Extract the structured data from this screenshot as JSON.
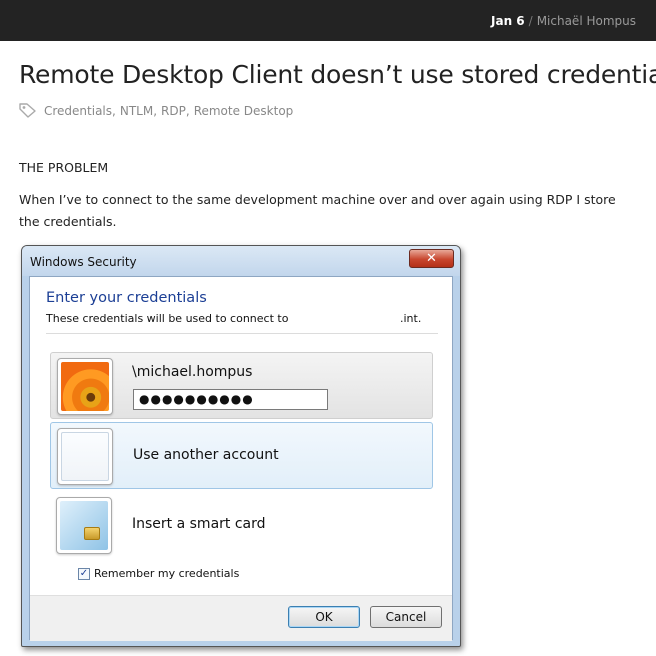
{
  "header": {
    "date": "Jan 6",
    "separator": "/",
    "author": "Michaël Hompus"
  },
  "post": {
    "title": "Remote Desktop Client doesn’t use stored credentials",
    "tags": [
      "Credentials",
      "NTLM",
      "RDP",
      "Remote Desktop"
    ],
    "section_heading": "THE PROBLEM",
    "paragraph": "When I’ve to connect to the same development machine over and over again using RDP I store the credentials."
  },
  "dialog": {
    "title": "Windows Security",
    "close_glyph": "✕",
    "heading": "Enter your credentials",
    "subtext": "These credentials will be used to connect to",
    "subtext_suffix": ".int.",
    "stored_user": "\\michael.hompus",
    "password_mask": "●●●●●●●●●●",
    "other_account_label": "Use another account",
    "smart_card_label": "Insert a smart card",
    "remember_label": "Remember my credentials",
    "remember_checked": true,
    "check_glyph": "✓",
    "ok_label": "OK",
    "cancel_label": "Cancel"
  },
  "colors": {
    "topbar": "#232323",
    "heading_blue": "#1c3f95",
    "frame": "#b9d1ea"
  }
}
